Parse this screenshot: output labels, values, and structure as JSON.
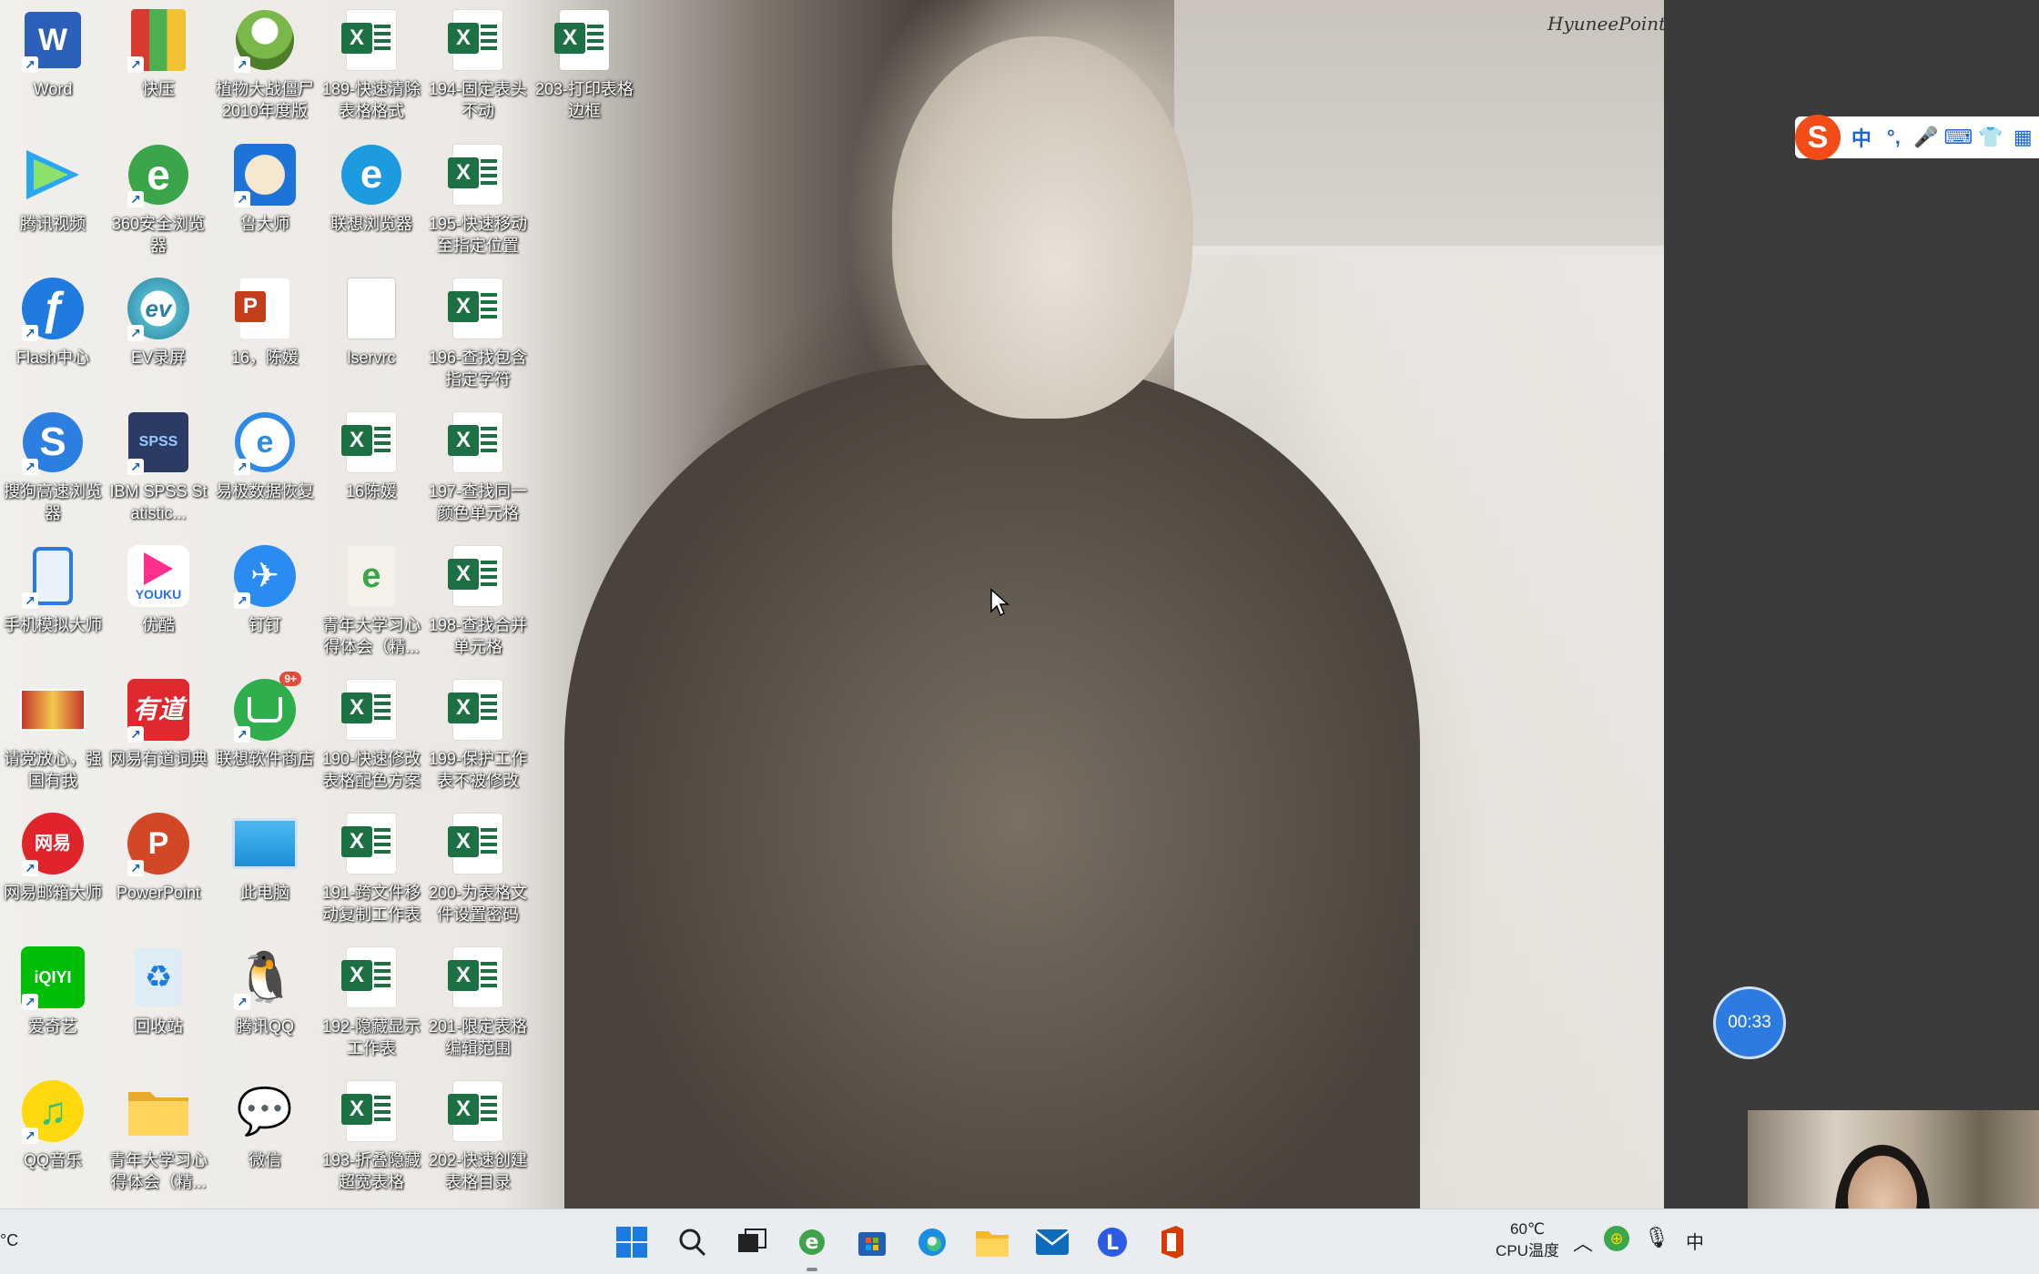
{
  "wallpaper": {
    "watermark": "HyuneePoint"
  },
  "icons": [
    {
      "label": "Word",
      "kind": "word"
    },
    {
      "label": "快压",
      "kind": "kuaiya"
    },
    {
      "label": "植物大战僵尸2010年度版",
      "kind": "pvz"
    },
    {
      "label": "189-快速清除表格格式",
      "kind": "excel"
    },
    {
      "label": "194-固定表头不动",
      "kind": "excel"
    },
    {
      "label": "203-打印表格边框",
      "kind": "excel"
    },
    {
      "label": "腾讯视频",
      "kind": "tencent-video"
    },
    {
      "label": "360安全浏览器",
      "kind": "browser-360"
    },
    {
      "label": "鲁大师",
      "kind": "ludashi"
    },
    {
      "label": "联想浏览器",
      "kind": "lenovo-browser"
    },
    {
      "label": "195-快速移动至指定位置",
      "kind": "excel"
    },
    {
      "label": "Flash中心",
      "kind": "flash"
    },
    {
      "label": "EV录屏",
      "kind": "ev"
    },
    {
      "label": "16，陈媛",
      "kind": "ppt-file"
    },
    {
      "label": "lservrc",
      "kind": "blank-file"
    },
    {
      "label": "196-查找包含指定字符",
      "kind": "excel"
    },
    {
      "label": "搜狗高速浏览器",
      "kind": "sogou"
    },
    {
      "label": "IBM SPSS Statistic...",
      "kind": "spss"
    },
    {
      "label": "易极数据恢复",
      "kind": "yiji"
    },
    {
      "label": "16陈媛",
      "kind": "excel"
    },
    {
      "label": "197-查找同一颜色单元格",
      "kind": "excel"
    },
    {
      "label": "手机模拟大师",
      "kind": "phone-sim"
    },
    {
      "label": "优酷",
      "kind": "youku"
    },
    {
      "label": "钉钉",
      "kind": "dingtalk"
    },
    {
      "label": "青年大学习心得体会（精...",
      "kind": "ie-file"
    },
    {
      "label": "198-查找合并单元格",
      "kind": "excel"
    },
    {
      "label": "请党放心，强国有我",
      "kind": "image-file"
    },
    {
      "label": "网易有道词典",
      "kind": "youdao"
    },
    {
      "label": "联想软件商店",
      "kind": "lenovo-store"
    },
    {
      "label": "190-快速修改表格配色方案",
      "kind": "excel"
    },
    {
      "label": "199-保护工作表不被修改",
      "kind": "excel"
    },
    {
      "label": "网易邮箱大师",
      "kind": "mail-master"
    },
    {
      "label": "PowerPoint",
      "kind": "powerpoint"
    },
    {
      "label": "此电脑",
      "kind": "this-pc"
    },
    {
      "label": "191-跨文件移动复制工作表",
      "kind": "excel"
    },
    {
      "label": "200-为表格文件设置密码",
      "kind": "excel"
    },
    {
      "label": "爱奇艺",
      "kind": "iqiyi"
    },
    {
      "label": "回收站",
      "kind": "recycle-bin"
    },
    {
      "label": "腾讯QQ",
      "kind": "qq"
    },
    {
      "label": "192-隐藏显示工作表",
      "kind": "excel"
    },
    {
      "label": "201-限定表格编辑范围",
      "kind": "excel"
    },
    {
      "label": "QQ音乐",
      "kind": "qq-music"
    },
    {
      "label": "青年大学习心得体会（精...",
      "kind": "folder"
    },
    {
      "label": "微信",
      "kind": "wechat"
    },
    {
      "label": "193-折叠隐藏超宽表格",
      "kind": "excel"
    },
    {
      "label": "202-快速创建表格目录",
      "kind": "excel"
    }
  ],
  "glyphs": {
    "excel_letter": "X",
    "word_letter": "W",
    "ppt_letter": "P",
    "iqiyi_text": "iQIYI",
    "youdao_text": "有道",
    "youku_text": "YOUKU",
    "mail_text": "网易",
    "spss_text": "SPSS",
    "dingtalk_glyph": "✈",
    "flash_glyph": "ƒ",
    "ev_text": "ev",
    "ie_glyph": "e",
    "sogou_glyph": "S",
    "lenovo_browser_glyph": "e",
    "recycle_glyph": "♻",
    "qq_glyph": "🐧",
    "music_glyph": "♫",
    "wechat_glyph": "💬",
    "pc_glyph": "🖥",
    "store_badge": "9+"
  },
  "ime": {
    "logo": "S",
    "items": [
      "中",
      "°,",
      "🎤",
      "⌨",
      "👕",
      "▦"
    ]
  },
  "timer": {
    "value": "00:33"
  },
  "taskbar": {
    "left_text": "°C",
    "icons": [
      "start-icon",
      "search-icon",
      "task-view-icon",
      "ie-browser-icon",
      "store-icon",
      "edge-icon",
      "file-explorer-icon",
      "mail-icon",
      "lenovo-icon",
      "office-icon"
    ],
    "temp_value": "60℃",
    "temp_label": "CPU温度",
    "tray_ime": "中"
  }
}
